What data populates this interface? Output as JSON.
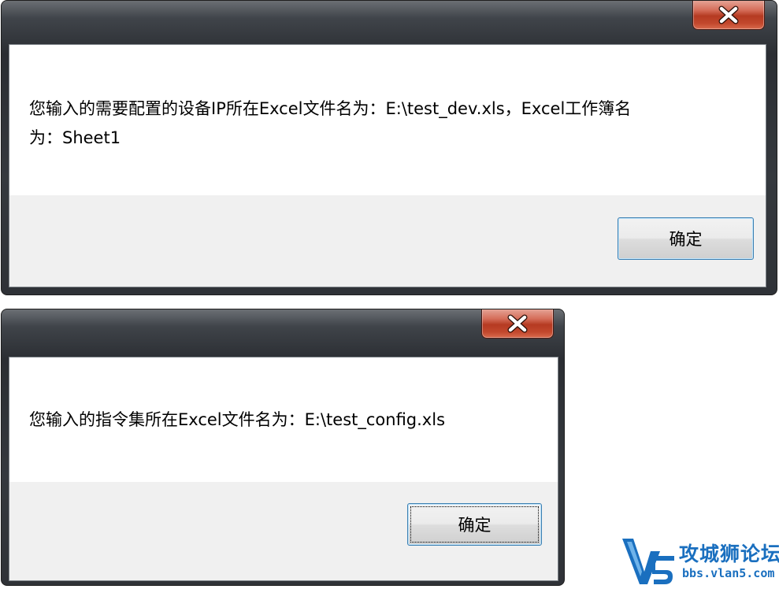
{
  "dialog1": {
    "close_glyph": "X",
    "message": "您输入的需要配置的设备IP所在Excel文件名为：E:\\test_dev.xls，Excel工作簿名\n为：Sheet1",
    "ok_label": "确定"
  },
  "dialog2": {
    "close_glyph": "X",
    "message": "您输入的指令集所在Excel文件名为：E:\\test_config.xls",
    "ok_label": "确定"
  },
  "watermark": {
    "title": "攻城狮论坛",
    "url": "bbs.vlan5.com",
    "logo_text": "V5"
  },
  "colors": {
    "close_button": "#c2482d",
    "button_border": "#3c7fb1",
    "button_area": "#f0f0f0",
    "watermark": "#1a6fbf"
  },
  "icons": [
    "close-icon",
    "v5-logo-icon"
  ]
}
